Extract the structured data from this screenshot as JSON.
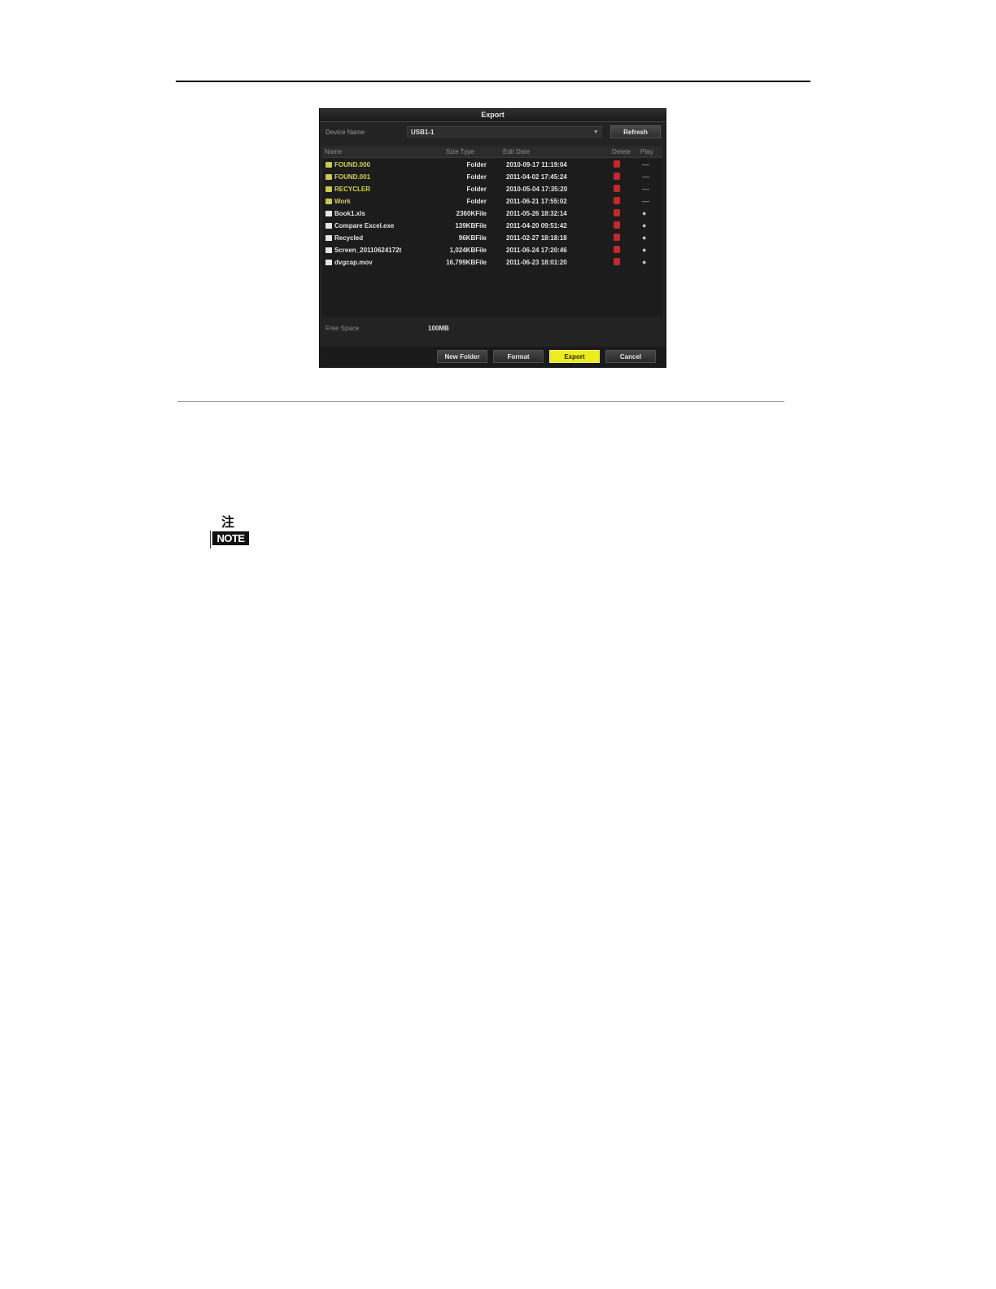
{
  "dialog": {
    "title": "Export",
    "device_label": "Device Name",
    "device_value": "USB1-1",
    "refresh_label": "Refresh",
    "columns": [
      "Name",
      "Size Type",
      "Edit Date",
      "Delete",
      "Play"
    ],
    "rows": [
      {
        "name": "FOUND.000",
        "size": "Folder",
        "date": "2010-09-17 11:19:04",
        "kind": "folder"
      },
      {
        "name": "FOUND.001",
        "size": "Folder",
        "date": "2011-04-02 17:45:24",
        "kind": "folder"
      },
      {
        "name": "RECYCLER",
        "size": "Folder",
        "date": "2010-05-04 17:35:20",
        "kind": "folder"
      },
      {
        "name": "Work",
        "size": "Folder",
        "date": "2011-06-21 17:55:02",
        "kind": "folder"
      },
      {
        "name": "Book1.xls",
        "size": "2360KFile",
        "date": "2011-05-26 18:32:14",
        "kind": "file"
      },
      {
        "name": "Compare Excel.exe",
        "size": "139KBFile",
        "date": "2011-04-20 09:51:42",
        "kind": "file"
      },
      {
        "name": "Recycled",
        "size": "96KBFile",
        "date": "2011-02-27 18:18:18",
        "kind": "file"
      },
      {
        "name": "Screen_20110624172t",
        "size": "1,024KBFile",
        "date": "2011-06-24 17:20:46",
        "kind": "file"
      },
      {
        "name": "dvgcap.mov",
        "size": "16,799KBFile",
        "date": "2011-06-23 18:01:20",
        "kind": "file"
      }
    ],
    "free_label": "Free Space",
    "free_value": "100MB",
    "buttons": {
      "new_folder": "New Folder",
      "format": "Format",
      "export": "Export",
      "cancel": "Cancel"
    },
    "colors": {
      "export_button": "#ecec1e",
      "folder_text": "#d4d442",
      "delete_icon": "#c8262a"
    }
  },
  "note": {
    "top_glyph": "注",
    "label": "NOTE"
  }
}
